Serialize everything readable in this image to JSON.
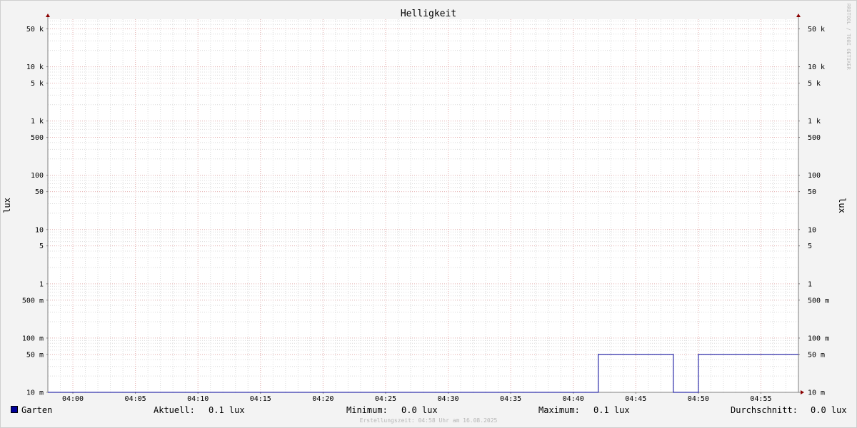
{
  "chart_data": {
    "type": "line",
    "title": "Helligkeit",
    "ylabel": "lux",
    "y_scale": "log",
    "ylim": [
      0.01,
      75
    ],
    "y_ticks": [
      {
        "value": 0.01,
        "label": "10 m"
      },
      {
        "value": 0.05,
        "label": "50 m"
      },
      {
        "value": 0.1,
        "label": "100 m"
      },
      {
        "value": 0.5,
        "label": "500 m"
      },
      {
        "value": 1,
        "label": "1"
      },
      {
        "value": 5,
        "label": "5"
      },
      {
        "value": 10,
        "label": "10"
      },
      {
        "value": 50,
        "label": "50"
      },
      {
        "value": 100,
        "label": "100"
      },
      {
        "value": 500,
        "label": "500"
      },
      {
        "value": 1000,
        "label": "1 k"
      },
      {
        "value": 5000,
        "label": "5 k"
      },
      {
        "value": 10000,
        "label": "10 k"
      },
      {
        "value": 50000,
        "label": "50 k"
      }
    ],
    "y_range_log": [
      0.01,
      75000
    ],
    "x_ticks": [
      "04:00",
      "04:05",
      "04:10",
      "04:15",
      "04:20",
      "04:25",
      "04:30",
      "04:35",
      "04:40",
      "04:45",
      "04:50",
      "04:55"
    ],
    "x_range": [
      "03:58",
      "04:58"
    ],
    "grid": true,
    "series": [
      {
        "name": "Garten",
        "color": "#000099",
        "points": [
          {
            "x": "03:58",
            "y": 0.01
          },
          {
            "x": "04:42",
            "y": 0.01
          },
          {
            "x": "04:42",
            "y": 0.05
          },
          {
            "x": "04:48",
            "y": 0.05
          },
          {
            "x": "04:48",
            "y": 0.01
          },
          {
            "x": "04:50",
            "y": 0.01
          },
          {
            "x": "04:50",
            "y": 0.05
          },
          {
            "x": "04:58",
            "y": 0.05
          }
        ]
      }
    ]
  },
  "legend": {
    "series_name": "Garten",
    "series_color": "#000099",
    "current_label": "Aktuell:",
    "current_value": "0.1 lux",
    "min_label": "Minimum:",
    "min_value": "0.0 lux",
    "max_label": "Maximum:",
    "max_value": "0.1 lux",
    "avg_label": "Durchschnitt:",
    "avg_value": "0.0 lux"
  },
  "footer": "Erstellungszeit: 04:58 Uhr am 16.08.2025",
  "watermark": "RRDTOOL / TOBI OETIKER",
  "colors": {
    "minor_grid": "#dcdcdc",
    "major_grid": "#e8b4b4",
    "axis": "#808080",
    "arrow": "#8b0000"
  }
}
